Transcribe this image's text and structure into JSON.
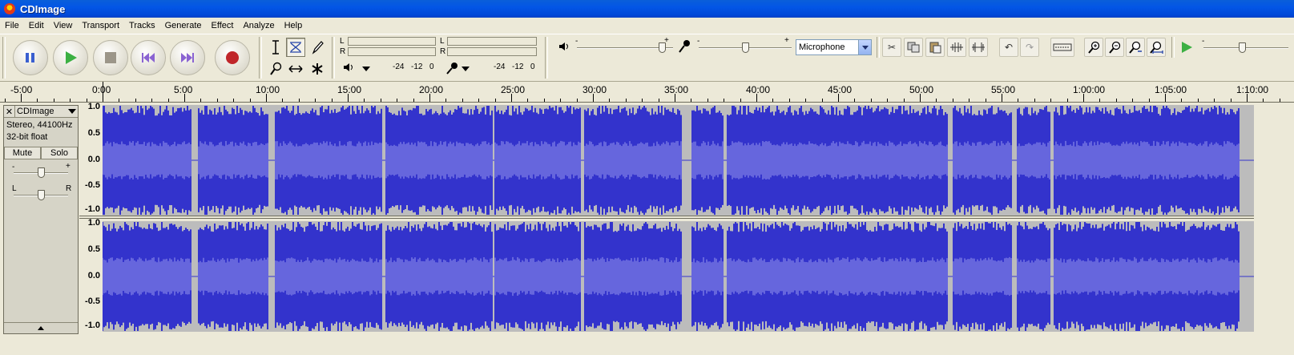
{
  "window": {
    "title": "CDImage"
  },
  "menu": [
    "File",
    "Edit",
    "View",
    "Transport",
    "Tracks",
    "Generate",
    "Effect",
    "Analyze",
    "Help"
  ],
  "transport": {
    "buttons": [
      {
        "name": "pause-button",
        "icon": "pause-icon",
        "color": "#3a5fd0"
      },
      {
        "name": "play-button",
        "icon": "play-icon",
        "color": "#3cb043"
      },
      {
        "name": "stop-button",
        "icon": "stop-icon",
        "color": "#9c9689"
      },
      {
        "name": "skip-start-button",
        "icon": "skip-start-icon",
        "color": "#8a63d2"
      },
      {
        "name": "skip-end-button",
        "icon": "skip-end-icon",
        "color": "#8a63d2"
      },
      {
        "name": "record-button",
        "icon": "record-icon",
        "color": "#c0262a"
      }
    ]
  },
  "meters": {
    "output": {
      "ch1": "L",
      "ch2": "R",
      "ticks": [
        "-24",
        "-12",
        "0"
      ]
    },
    "input": {
      "ch1": "L",
      "ch2": "R",
      "ticks": [
        "-24",
        "-12",
        "0"
      ]
    }
  },
  "mixer": {
    "output_min": "-",
    "output_max": "+",
    "output_level": 0.88,
    "input_min": "-",
    "input_max": "+",
    "input_level": 0.5,
    "input_source": "Microphone"
  },
  "playback_speed": {
    "min": "-",
    "level": 0.45
  },
  "ruler": {
    "labels": [
      "-5:00",
      "0:00",
      "5:00",
      "10:00",
      "15:00",
      "20:00",
      "25:00",
      "30:00",
      "35:00",
      "40:00",
      "45:00",
      "50:00",
      "55:00",
      "1:00:00",
      "1:05:00",
      "1:10:00"
    ],
    "x_values": [
      -5,
      0,
      5,
      10,
      15,
      20,
      25,
      30,
      35,
      40,
      45,
      50,
      55,
      60,
      65,
      70
    ],
    "cursor": 0
  },
  "track": {
    "name": "CDImage",
    "info1": "Stereo, 44100Hz",
    "info2": "32-bit float",
    "mute": "Mute",
    "solo": "Solo",
    "gain_min": "-",
    "gain_max": "+",
    "pan_left": "L",
    "pan_right": "R",
    "gain_level": 0.5,
    "pan_level": 0.5,
    "amplitude_ticks": [
      "1.0",
      "0.5",
      "0.0",
      "-0.5",
      "-1.0"
    ],
    "duration_minutes": 70.25,
    "wave_color": "#3333cc",
    "rms_color": "#6666dd",
    "background": "#bcbcbc"
  }
}
